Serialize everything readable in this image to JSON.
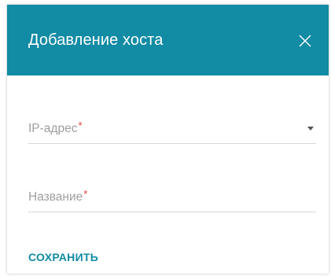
{
  "dialog": {
    "title": "Добавление хоста",
    "close_icon": "close-icon"
  },
  "form": {
    "ip_field": {
      "label": "IP-адрес",
      "required_mark": "*",
      "icon": "chevron-down-icon"
    },
    "name_field": {
      "label": "Название",
      "required_mark": "*"
    },
    "save_label": "СОХРАНИТЬ"
  },
  "colors": {
    "header": "#128ba4",
    "accent": "#128ba4",
    "required": "#e53935"
  }
}
